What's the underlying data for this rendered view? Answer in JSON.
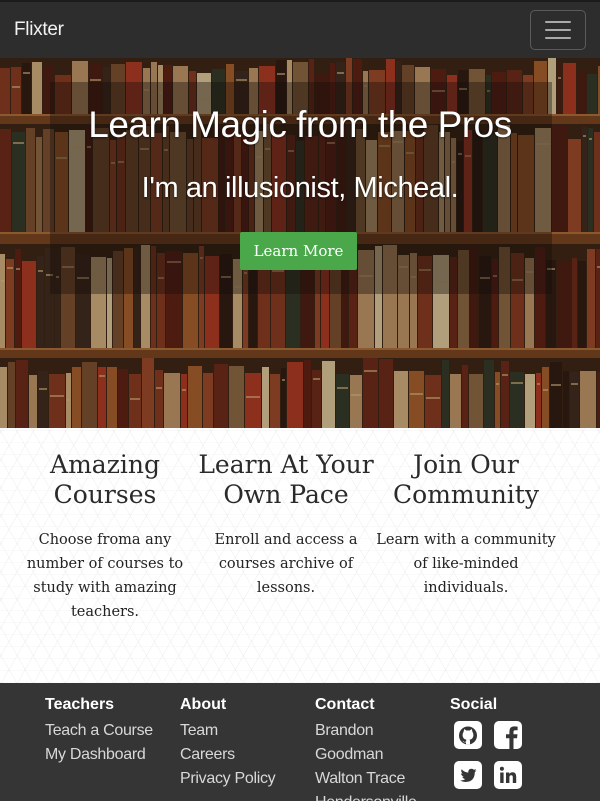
{
  "navbar": {
    "brand": "Flixter"
  },
  "hero": {
    "title": "Learn Magic from the Pros",
    "subtitle": "I'm an illusionist, Micheal.",
    "cta_label": "Learn More",
    "cta_color": "#4aa84a"
  },
  "features": [
    {
      "title": "Amazing Courses",
      "text": "Choose froma any number of courses to study with amazing teachers."
    },
    {
      "title": "Learn At Your Own Pace",
      "text": "Enroll and access a courses archive of lessons."
    },
    {
      "title": "Join Our Community",
      "text": "Learn with a community of like-minded individuals."
    }
  ],
  "footer": {
    "teachers": {
      "heading": "Teachers",
      "links": [
        "Teach a Course",
        "My Dashboard"
      ]
    },
    "about": {
      "heading": "About",
      "links": [
        "Team",
        "Careers",
        "Privacy Policy"
      ]
    },
    "contact": {
      "heading": "Contact",
      "lines": [
        "Brandon",
        "Goodman",
        "Walton Trace",
        "Hendersonville"
      ]
    },
    "social": {
      "heading": "Social",
      "icons": [
        "github-icon",
        "facebook-icon",
        "twitter-icon",
        "linkedin-icon"
      ]
    }
  }
}
